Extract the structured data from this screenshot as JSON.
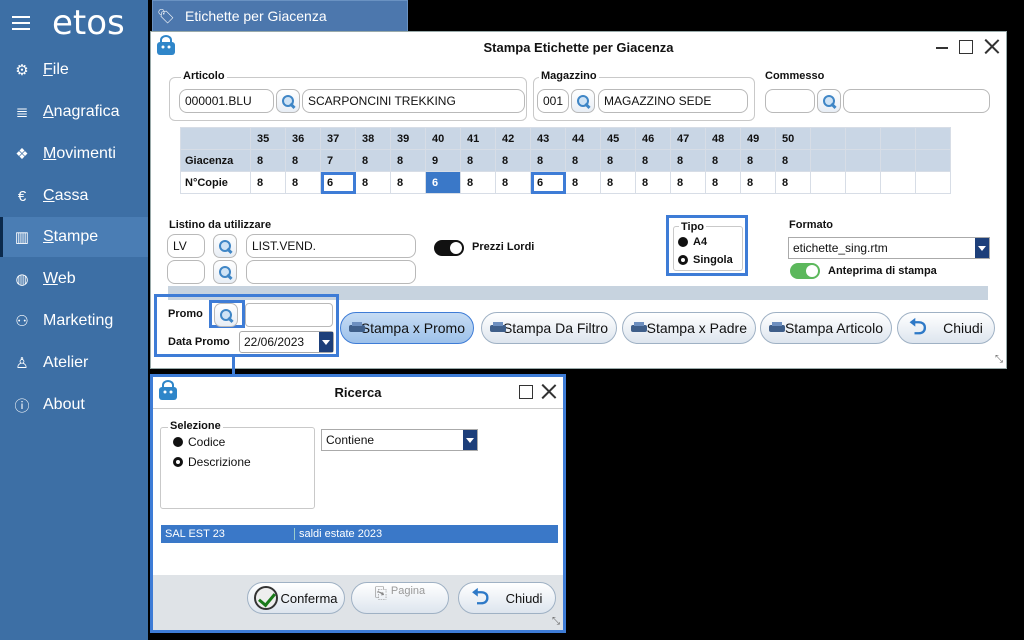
{
  "app": {
    "logo": "etos"
  },
  "nav": [
    {
      "label": "File",
      "icon": "gear-icon",
      "glyph": "⚙",
      "underline": "F",
      "rest": "ile"
    },
    {
      "label": "Anagrafica",
      "icon": "database-icon",
      "glyph": "≣",
      "underline": "A",
      "rest": "nagrafica"
    },
    {
      "label": "Movimenti",
      "icon": "boxes-icon",
      "glyph": "❖",
      "underline": "M",
      "rest": "ovimenti"
    },
    {
      "label": "Cassa",
      "icon": "euro-icon",
      "glyph": "€",
      "underline": "C",
      "rest": "assa"
    },
    {
      "label": "Stampe",
      "icon": "chart-icon",
      "glyph": "▥",
      "underline": "S",
      "rest": "tampe"
    },
    {
      "label": "Web",
      "icon": "globe-icon",
      "glyph": "◍",
      "underline": "W",
      "rest": "eb"
    },
    {
      "label": "Marketing",
      "icon": "users-icon",
      "glyph": "⚇",
      "underline": "",
      "rest": "Marketing"
    },
    {
      "label": "Atelier",
      "icon": "mannequin-icon",
      "glyph": "♙",
      "underline": "",
      "rest": "Atelier"
    },
    {
      "label": "About",
      "icon": "info-icon",
      "glyph": "ⓘ",
      "underline": "",
      "rest": "About"
    }
  ],
  "tab": {
    "label": "Etichette per Giacenza",
    "icon": "tag-icon"
  },
  "window": {
    "title": "Stampa Etichette per Giacenza",
    "articolo": {
      "label": "Articolo",
      "code": "000001.BLU",
      "desc": "SCARPONCINI TREKKING"
    },
    "magazzino": {
      "label": "Magazzino",
      "code": "001",
      "desc": "MAGAZZINO SEDE"
    },
    "commesso": {
      "label": "Commesso",
      "code": "",
      "desc": ""
    },
    "sizes": [
      "35",
      "36",
      "37",
      "38",
      "39",
      "40",
      "41",
      "42",
      "43",
      "44",
      "45",
      "46",
      "47",
      "48",
      "49",
      "50",
      "",
      "",
      "",
      ""
    ],
    "giacenza_label": "Giacenza",
    "giacenza": [
      "8",
      "8",
      "7",
      "8",
      "8",
      "9",
      "8",
      "8",
      "8",
      "8",
      "8",
      "8",
      "8",
      "8",
      "8",
      "8",
      "",
      "",
      "",
      ""
    ],
    "copie_label": "N°Copie",
    "copie": [
      "8",
      "8",
      "6",
      "8",
      "8",
      "6",
      "8",
      "8",
      "6",
      "8",
      "8",
      "8",
      "8",
      "8",
      "8",
      "8",
      "",
      "",
      "",
      ""
    ],
    "listino": {
      "label": "Listino da utilizzare",
      "code": "LV",
      "desc": "LIST.VEND.",
      "code2": "",
      "desc2": ""
    },
    "prezzi_lordi": "Prezzi Lordi",
    "tipo": {
      "label": "Tipo",
      "opt1": "A4",
      "opt2": "Singola",
      "selected": "Singola"
    },
    "formato": {
      "label": "Formato",
      "value": "etichette_sing.rtm"
    },
    "anteprima": "Anteprima di stampa",
    "promo": {
      "label": "Promo",
      "value": "",
      "data_label": "Data Promo",
      "data_value": "22/06/2023"
    },
    "buttons": {
      "stampa_promo": "Stampa x Promo",
      "stampa_filtro": "Stampa Da Filtro",
      "stampa_padre": "Stampa x Padre",
      "stampa_articolo": "Stampa Articolo",
      "chiudi": "Chiudi"
    }
  },
  "dialog": {
    "title": "Ricerca",
    "selezione": {
      "label": "Selezione",
      "opt1": "Codice",
      "opt2": "Descrizione",
      "selected": "Descrizione"
    },
    "mode": "Contiene",
    "row": {
      "code": "SAL EST 23",
      "desc": "saldi estate 2023"
    },
    "buttons": {
      "conferma": "Conferma",
      "pagina": "Pagina",
      "chiudi": "Chiudi"
    }
  },
  "colors": {
    "sidebar": "#3d6fa5",
    "accent": "#3e7cd6",
    "selected_row": "#3a78c8"
  }
}
